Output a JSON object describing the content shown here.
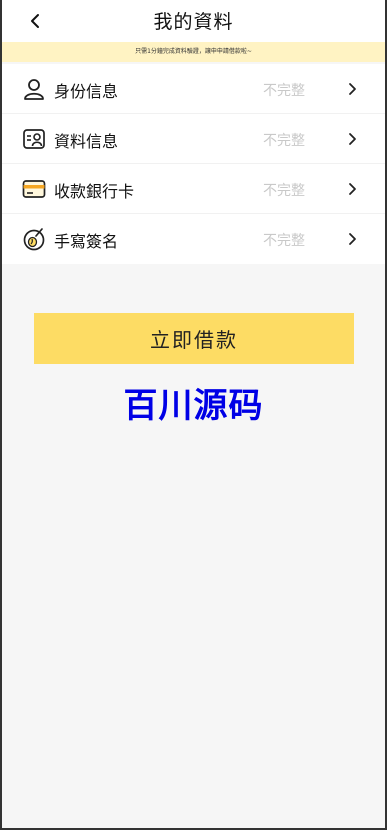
{
  "header": {
    "title": "我的資料"
  },
  "notice": {
    "text": "只需1分鐘完成資料驗證，讓申申請借款啦~"
  },
  "items": [
    {
      "label": "身份信息",
      "status": "不完整",
      "icon": "person-icon"
    },
    {
      "label": "資料信息",
      "status": "不完整",
      "icon": "id-card-icon"
    },
    {
      "label": "收款銀行卡",
      "status": "不完整",
      "icon": "bank-card-icon"
    },
    {
      "label": "手寫簽名",
      "status": "不完整",
      "icon": "signature-icon"
    }
  ],
  "loan_button": {
    "label": "立即借款"
  },
  "watermark": {
    "text": "百川源码"
  },
  "colors": {
    "accent": "#fddc64",
    "notice_bg": "#fff3c3",
    "watermark": "#0000e6"
  }
}
